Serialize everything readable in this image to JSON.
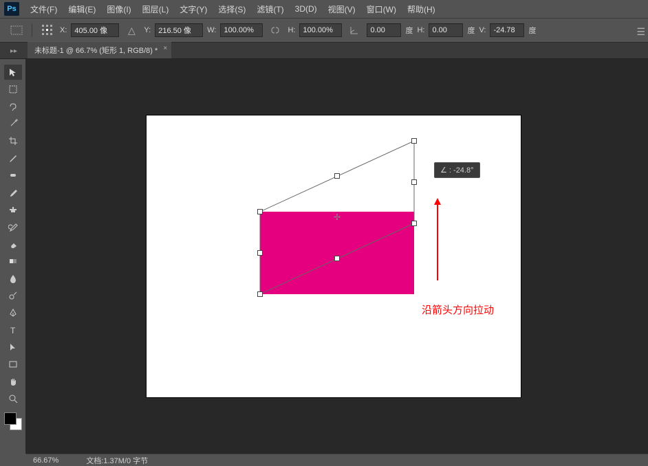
{
  "app": {
    "logo": "Ps"
  },
  "menu": {
    "file": "文件(F)",
    "edit": "编辑(E)",
    "image": "图像(I)",
    "layer": "图层(L)",
    "type": "文字(Y)",
    "select": "选择(S)",
    "filter": "滤镜(T)",
    "threeD": "3D(D)",
    "view": "视图(V)",
    "window": "窗口(W)",
    "help": "帮助(H)"
  },
  "options": {
    "x_label": "X:",
    "x_value": "405.00 像",
    "y_label": "Y:",
    "y_value": "216.50 像",
    "w_label": "W:",
    "w_value": "100.00%",
    "h_label": "H:",
    "h_value": "100.00%",
    "angle_value": "0.00",
    "angle_unit": "度",
    "h_skew_label": "H:",
    "h_skew_value": "0.00",
    "h_skew_unit": "度",
    "v_skew_label": "V:",
    "v_skew_value": "-24.78",
    "v_skew_unit": "度"
  },
  "tab": {
    "title": "未标题-1 @ 66.7% (矩形 1, RGB/8) *",
    "close": "×"
  },
  "tooltip": {
    "text": "∠ : -24.8°"
  },
  "annotation": {
    "text": "沿箭头方向拉动"
  },
  "status": {
    "zoom": "66.67%",
    "doc_info": "文档:1.37M/0 字节"
  },
  "colors": {
    "rect": "#e4007f",
    "annotation": "#ff0000"
  }
}
